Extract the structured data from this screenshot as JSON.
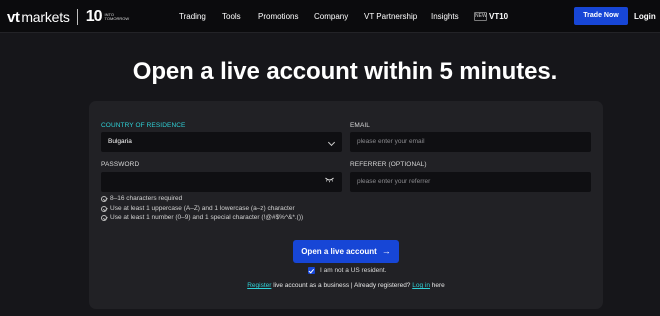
{
  "header": {
    "logo": {
      "brand": "vt",
      "word": "markets",
      "ten": "10",
      "tagline_line1": "INTO",
      "tagline_line2": "TOMORROW"
    },
    "nav": [
      "Trading",
      "Tools",
      "Promotions",
      "Company",
      "VT Partnership",
      "Insights"
    ],
    "new_badge": "NEW",
    "vt10_label": "VT10",
    "trade_now": "Trade Now",
    "login": "Login"
  },
  "headline": "Open a live account within 5 minutes.",
  "form": {
    "country_label": "COUNTRY OF RESIDENCE",
    "country_value": "Bulgaria",
    "email_label": "EMAIL",
    "email_placeholder": "please enter your email",
    "password_label": "PASSWORD",
    "password_value": "",
    "referrer_label": "REFERRER (OPTIONAL)",
    "referrer_placeholder": "please enter your referrer",
    "rules": [
      "8–16 characters required",
      "Use at least 1 uppercase (A–Z) and 1 lowercase (a–z) character",
      "Use at least 1 number (0–9) and 1 special character (!@#$%^&*.())"
    ],
    "submit": "Open a live account",
    "not_us_checked": true,
    "not_us_label": "I am not a US resident.",
    "footer": {
      "register_link": "Register",
      "middle_text": " live account as a business | Already registered? ",
      "login_link": "Log in",
      "end_text": " here"
    }
  },
  "colors": {
    "accent": "#2fd1d7",
    "primary": "#1746d6",
    "background": "#16161a",
    "card": "#212125"
  }
}
